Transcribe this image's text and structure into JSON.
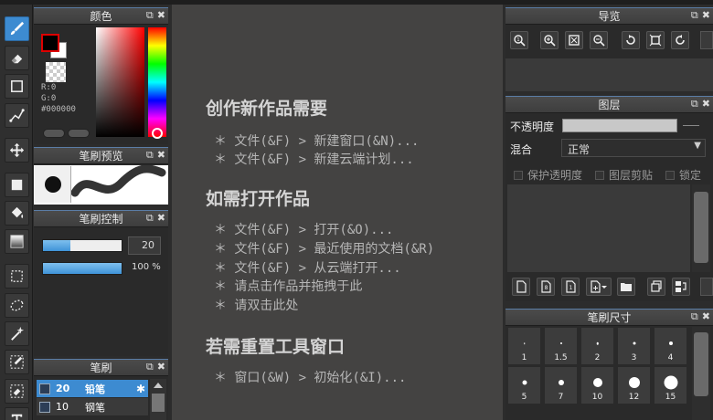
{
  "panels": {
    "color": {
      "title": "颜色",
      "r": "R:0",
      "g": "G:0",
      "hex": "#000000"
    },
    "preview": {
      "title": "笔刷预览"
    },
    "control": {
      "title": "笔刷控制",
      "size_value": "20",
      "opacity_value": "100 %",
      "size_fraction": 0.35,
      "opacity_fraction": 1.0
    },
    "brush": {
      "title": "笔刷",
      "items": [
        {
          "size": "20",
          "name": "铅笔"
        },
        {
          "size": "10",
          "name": "钢笔"
        }
      ]
    },
    "navigator": {
      "title": "导览"
    },
    "layer": {
      "title": "图层",
      "opacity_label": "不透明度",
      "blend_label": "混合",
      "blend_value": "正常",
      "protect_alpha": "保护透明度",
      "clipping": "图层剪贴",
      "lock": "锁定"
    },
    "brush_size": {
      "title": "笔刷尺寸",
      "sizes": [
        "1",
        "1.5",
        "2",
        "3",
        "4",
        "5",
        "7",
        "10",
        "12",
        "15"
      ]
    }
  },
  "canvas": {
    "sections": [
      {
        "heading": "创作新作品需要",
        "lines": [
          "＊ 文件(&F) > 新建窗口(&N)...",
          "＊ 文件(&F) > 新建云端计划..."
        ]
      },
      {
        "heading": "如需打开作品",
        "lines": [
          "＊ 文件(&F) > 打开(&O)...",
          "＊ 文件(&F) > 最近使用的文档(&R)",
          "＊ 文件(&F) > 从云端打开...",
          "＊ 请点击作品并拖拽于此",
          "＊ 请双击此处"
        ]
      },
      {
        "heading": "若需重置工具窗口",
        "lines": [
          "＊ 窗口(&W) > 初始化(&I)..."
        ]
      }
    ]
  },
  "colors": {
    "accent": "#3d8bd1",
    "canvas_bg": "#444342",
    "panel_bg": "#2a2a2a"
  }
}
